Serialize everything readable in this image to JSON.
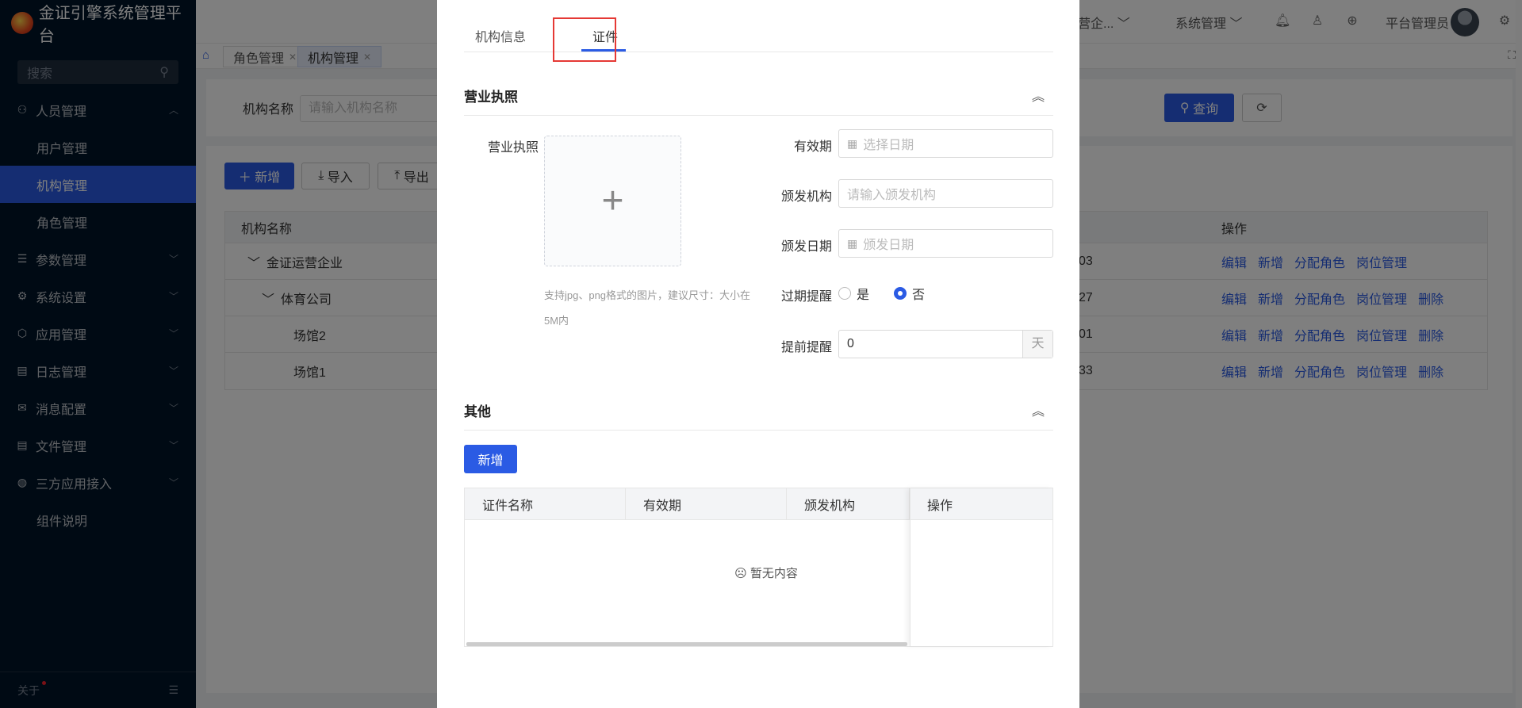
{
  "app": {
    "title": "金证引擎系统管理平台"
  },
  "sidebar": {
    "search_placeholder": "搜索",
    "items": [
      {
        "label": "人员管理",
        "icon": "user-icon",
        "arrow": "︿"
      },
      {
        "label": "用户管理"
      },
      {
        "label": "机构管理",
        "active": true
      },
      {
        "label": "角色管理"
      },
      {
        "label": "参数管理",
        "icon": "sliders-icon",
        "arrow": "﹀"
      },
      {
        "label": "系统设置",
        "icon": "gear-icon",
        "arrow": "﹀"
      },
      {
        "label": "应用管理",
        "icon": "box-icon",
        "arrow": "﹀"
      },
      {
        "label": "日志管理",
        "icon": "document-icon",
        "arrow": "﹀"
      },
      {
        "label": "消息配置",
        "icon": "message-icon",
        "arrow": "﹀"
      },
      {
        "label": "文件管理",
        "icon": "file-icon",
        "arrow": "﹀"
      },
      {
        "label": "三方应用接入",
        "icon": "globe-icon",
        "arrow": "﹀"
      },
      {
        "label": "组件说明"
      }
    ],
    "about": "关于"
  },
  "header": {
    "org_label": "营企...",
    "system_label": "系统管理",
    "user_label": "平台管理员"
  },
  "tabs": [
    {
      "label": "角色管理"
    },
    {
      "label": "机构管理",
      "active": true
    }
  ],
  "query": {
    "label": "机构名称",
    "placeholder": "请输入机构名称",
    "query_button": "查询"
  },
  "actions": {
    "add": "新增",
    "import": "导入",
    "export": "导出"
  },
  "table": {
    "headers": {
      "name": "机构名称",
      "ops": "操作"
    },
    "rows": [
      {
        "name": "金证运营企业",
        "code": "03",
        "ops": [
          "编辑",
          "新增",
          "分配角色",
          "岗位管理"
        ]
      },
      {
        "name": "体育公司",
        "code": "27",
        "ops": [
          "编辑",
          "新增",
          "分配角色",
          "岗位管理",
          "删除"
        ]
      },
      {
        "name": "场馆2",
        "code": "01",
        "ops": [
          "编辑",
          "新增",
          "分配角色",
          "岗位管理",
          "删除"
        ]
      },
      {
        "name": "场馆1",
        "code": "33",
        "ops": [
          "编辑",
          "新增",
          "分配角色",
          "岗位管理",
          "删除"
        ]
      }
    ]
  },
  "modal": {
    "tabs": [
      {
        "label": "机构信息"
      },
      {
        "label": "证件",
        "active": true
      }
    ],
    "license_section": {
      "title": "营业执照",
      "upload_label": "营业执照",
      "upload_tip": "支持jpg、png格式的图片，建议尺寸：大小在5M内",
      "validity_label": "有效期",
      "validity_placeholder": "选择日期",
      "issuer_label": "颁发机构",
      "issuer_placeholder": "请输入颁发机构",
      "issue_date_label": "颁发日期",
      "issue_date_placeholder": "颁发日期",
      "expire_remind_label": "过期提醒",
      "radio_yes": "是",
      "radio_no": "否",
      "radio_selected": "否",
      "advance_label": "提前提醒",
      "advance_value": "0",
      "advance_unit": "天"
    },
    "other_section": {
      "title": "其他",
      "add_button": "新增",
      "columns": [
        "证件名称",
        "有效期",
        "颁发机构",
        "操作"
      ],
      "empty_text": "暂无内容"
    }
  }
}
